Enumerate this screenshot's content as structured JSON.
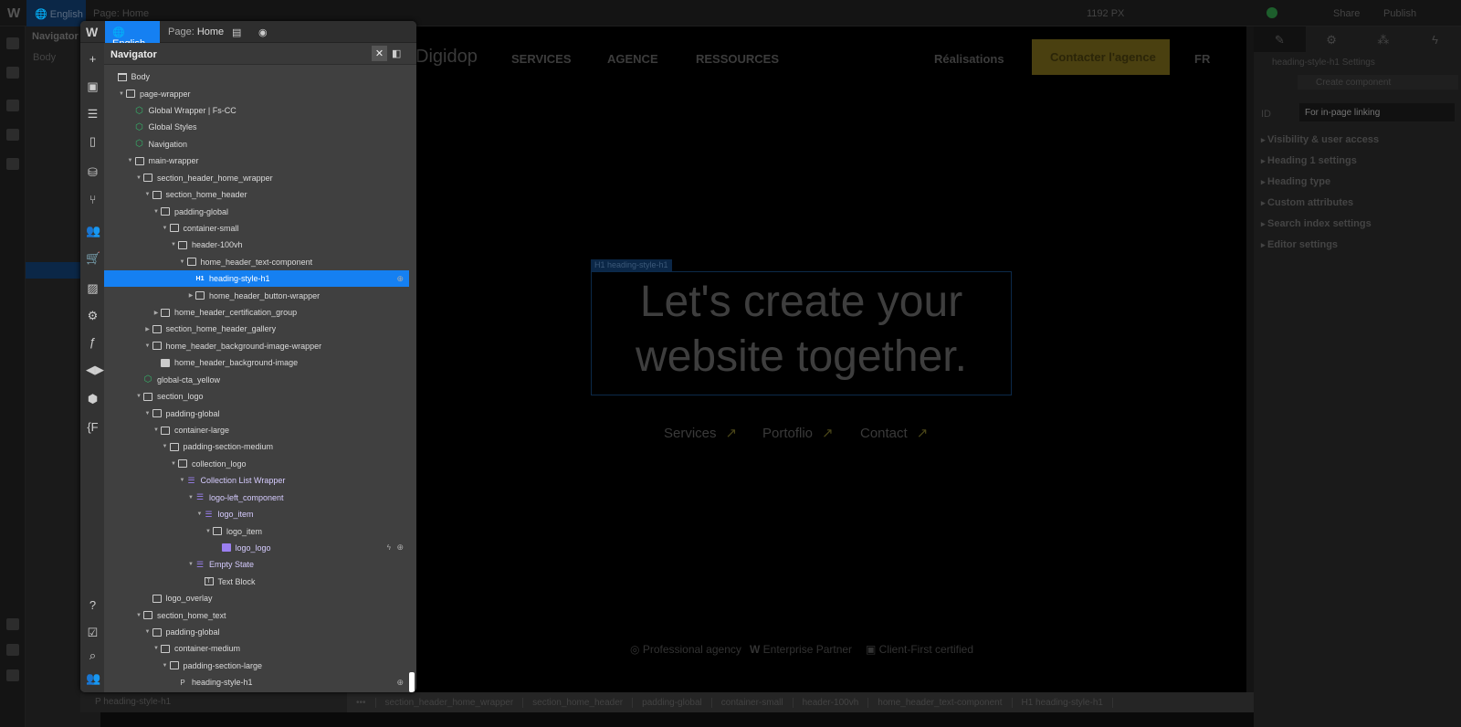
{
  "topbar": {
    "language": "English",
    "page_label": "Page:",
    "page_name": "Home",
    "width": "1192 PX",
    "share": "Share",
    "publish": "Publish"
  },
  "bg_navigator": {
    "title": "Navigator",
    "body": "Body"
  },
  "popup": {
    "language": "English",
    "page_label": "Page:",
    "page_name": "Home",
    "navigator_title": "Navigator",
    "left_icons": [
      "add-icon",
      "cube-icon",
      "layers-icon",
      "pages-icon",
      "cms-icon",
      "logic-icon",
      "users-icon",
      "ecommerce-icon",
      "assets-icon",
      "settings-icon",
      "finsweet-icon",
      "relume-icon",
      "box-icon",
      "code-icon",
      "help-icon",
      "check-icon",
      "search-icon",
      "team-icon"
    ],
    "tree": [
      {
        "label": "Body",
        "depth": 0,
        "icon": "body",
        "arrow": ""
      },
      {
        "label": "page-wrapper",
        "depth": 1,
        "icon": "box",
        "arrow": "down"
      },
      {
        "label": "Global Wrapper | Fs-CC",
        "depth": 2,
        "icon": "comp",
        "arrow": ""
      },
      {
        "label": "Global Styles",
        "depth": 2,
        "icon": "comp",
        "arrow": ""
      },
      {
        "label": "Navigation",
        "depth": 2,
        "icon": "comp",
        "arrow": ""
      },
      {
        "label": "main-wrapper",
        "depth": 2,
        "icon": "box",
        "arrow": "down"
      },
      {
        "label": "section_header_home_wrapper",
        "depth": 3,
        "icon": "box",
        "arrow": "down"
      },
      {
        "label": "section_home_header",
        "depth": 4,
        "icon": "box",
        "arrow": "down"
      },
      {
        "label": "padding-global",
        "depth": 5,
        "icon": "box",
        "arrow": "down"
      },
      {
        "label": "container-small",
        "depth": 6,
        "icon": "box",
        "arrow": "down"
      },
      {
        "label": "header-100vh",
        "depth": 7,
        "icon": "box",
        "arrow": "down"
      },
      {
        "label": "home_header_text-component",
        "depth": 8,
        "icon": "box",
        "arrow": "down"
      },
      {
        "label": "heading-style-h1",
        "depth": 9,
        "icon": "h1",
        "arrow": "",
        "selected": true,
        "globe": true
      },
      {
        "label": "home_header_button-wrapper",
        "depth": 9,
        "icon": "box",
        "arrow": "right"
      },
      {
        "label": "home_header_certification_group",
        "depth": 5,
        "icon": "box",
        "arrow": "right"
      },
      {
        "label": "section_home_header_gallery",
        "depth": 4,
        "icon": "box",
        "arrow": "right"
      },
      {
        "label": "home_header_background-image-wrapper",
        "depth": 4,
        "icon": "box",
        "arrow": "down"
      },
      {
        "label": "home_header_background-image",
        "depth": 5,
        "icon": "img",
        "arrow": ""
      },
      {
        "label": "global-cta_yellow",
        "depth": 3,
        "icon": "comp",
        "arrow": ""
      },
      {
        "label": "section_logo",
        "depth": 3,
        "icon": "box",
        "arrow": "down"
      },
      {
        "label": "padding-global",
        "depth": 4,
        "icon": "box",
        "arrow": "down"
      },
      {
        "label": "container-large",
        "depth": 5,
        "icon": "box",
        "arrow": "down"
      },
      {
        "label": "padding-section-medium",
        "depth": 6,
        "icon": "box",
        "arrow": "down"
      },
      {
        "label": "collection_logo",
        "depth": 7,
        "icon": "box",
        "arrow": "down"
      },
      {
        "label": "Collection List Wrapper",
        "depth": 8,
        "icon": "coll",
        "arrow": "down"
      },
      {
        "label": "logo-left_component",
        "depth": 9,
        "icon": "coll",
        "arrow": "down"
      },
      {
        "label": "logo_item",
        "depth": 10,
        "icon": "coll",
        "arrow": "down"
      },
      {
        "label": "logo_item",
        "depth": 11,
        "icon": "box",
        "arrow": "down"
      },
      {
        "label": "logo_logo",
        "depth": 12,
        "icon": "pimg",
        "arrow": "",
        "globe": true,
        "bolt": true
      },
      {
        "label": "Empty State",
        "depth": 9,
        "icon": "coll",
        "arrow": "down"
      },
      {
        "label": "Text Block",
        "depth": 10,
        "icon": "tb",
        "arrow": ""
      },
      {
        "label": "logo_overlay",
        "depth": 4,
        "icon": "box",
        "arrow": ""
      },
      {
        "label": "section_home_text",
        "depth": 3,
        "icon": "box",
        "arrow": "down"
      },
      {
        "label": "padding-global",
        "depth": 4,
        "icon": "box",
        "arrow": "down"
      },
      {
        "label": "container-medium",
        "depth": 5,
        "icon": "box",
        "arrow": "down"
      },
      {
        "label": "padding-section-large",
        "depth": 6,
        "icon": "box",
        "arrow": "down"
      },
      {
        "label": "heading-style-h1",
        "depth": 7,
        "icon": "p",
        "arrow": "",
        "globe": true
      }
    ]
  },
  "site": {
    "logo": "Digidop",
    "nav": [
      "SERVICES",
      "AGENCE",
      "RESSOURCES"
    ],
    "realisations": "Réalisations",
    "cta": "Contacter l'agence",
    "lang": "FR",
    "selected_tag": "H1 heading-style-h1",
    "heading": "Let's create your website together.",
    "links": [
      "Services",
      "Portoflio",
      "Contact"
    ],
    "certs": [
      "Professional agency",
      "Enterprise Partner",
      "Client-First certified"
    ]
  },
  "right_panel": {
    "settings_title": "heading-style-h1 Settings",
    "create_component": "Create component",
    "id_label": "ID",
    "id_placeholder": "For in-page linking",
    "sections": [
      "Visibility & user access",
      "Heading 1 settings",
      "Heading type",
      "Custom attributes",
      "Search index settings",
      "Editor settings"
    ]
  },
  "breadcrumbs": [
    "section_header_home_wrapper",
    "section_home_header",
    "padding-global",
    "container-small",
    "header-100vh",
    "home_header_text-component",
    "H1 heading-style-h1"
  ],
  "bottom_left": "P heading-style-h1",
  "colors": {
    "accent": "#1580f2",
    "component": "#35b56a",
    "collection": "#9b7ff0",
    "cta": "#f5d327"
  }
}
